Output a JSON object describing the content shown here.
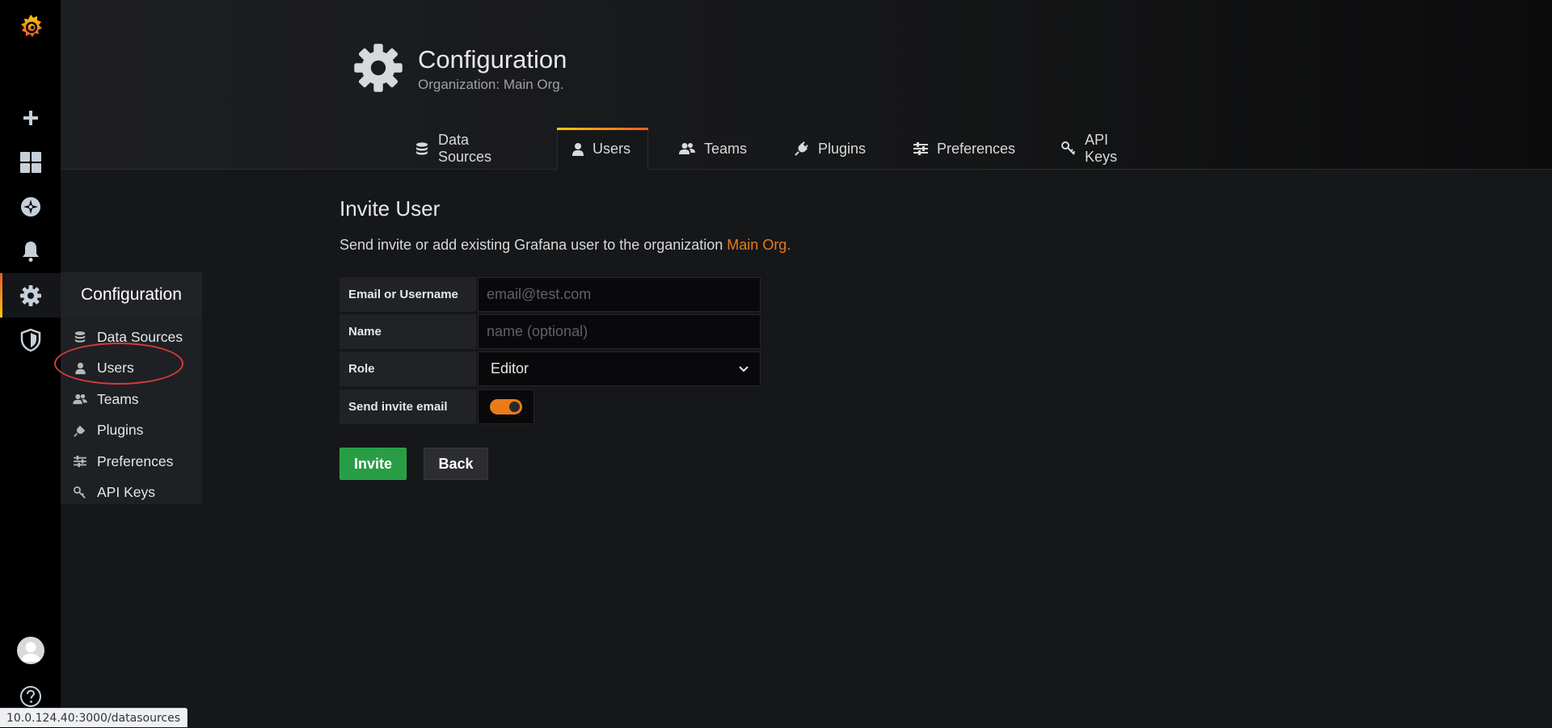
{
  "header": {
    "title": "Configuration",
    "subtitle": "Organization: Main Org."
  },
  "tabs": [
    {
      "label": "Data Sources",
      "icon": "database-icon"
    },
    {
      "label": "Users",
      "icon": "user-icon",
      "active": true
    },
    {
      "label": "Teams",
      "icon": "users-icon"
    },
    {
      "label": "Plugins",
      "icon": "plug-icon"
    },
    {
      "label": "Preferences",
      "icon": "sliders-icon"
    },
    {
      "label": "API Keys",
      "icon": "key-icon"
    }
  ],
  "sidemenu": {
    "items": [
      "logo",
      "create",
      "dashboards",
      "explore",
      "alerting",
      "configuration",
      "server-admin"
    ],
    "active": "configuration"
  },
  "dropdown": {
    "title": "Configuration",
    "items": [
      {
        "label": "Data Sources",
        "icon": "database-icon"
      },
      {
        "label": "Users",
        "icon": "user-icon"
      },
      {
        "label": "Teams",
        "icon": "users-icon"
      },
      {
        "label": "Plugins",
        "icon": "plug-icon"
      },
      {
        "label": "Preferences",
        "icon": "sliders-icon"
      },
      {
        "label": "API Keys",
        "icon": "key-icon"
      }
    ]
  },
  "invite": {
    "title": "Invite User",
    "description": "Send invite or add existing Grafana user to the organization ",
    "org_name": "Main Org.",
    "fields": {
      "email_label": "Email or Username",
      "email_placeholder": "email@test.com",
      "email_value": "",
      "name_label": "Name",
      "name_placeholder": "name (optional)",
      "name_value": "",
      "role_label": "Role",
      "role_value": "Editor",
      "send_label": "Send invite email",
      "send_enabled": true
    },
    "invite_button": "Invite",
    "back_button": "Back"
  },
  "statusbar": {
    "url": "10.0.124.40:3000/datasources"
  },
  "colors": {
    "accent_orange": "#eb7b18",
    "invite_green": "#299c46",
    "annotation_red": "#d33b3b"
  }
}
